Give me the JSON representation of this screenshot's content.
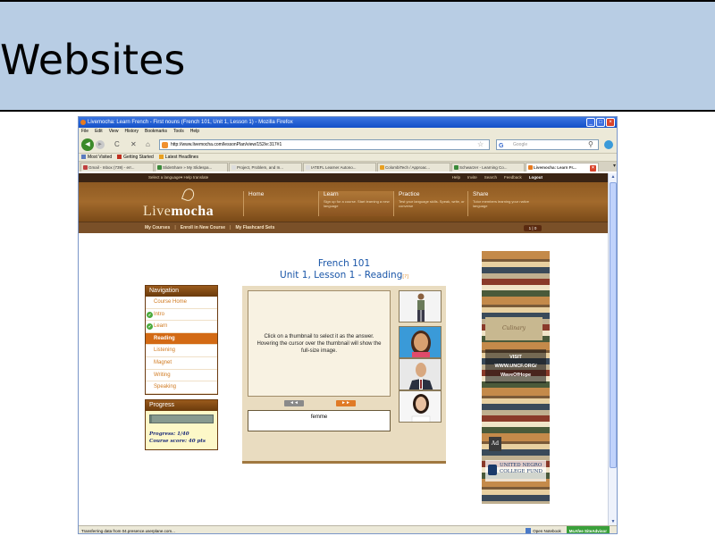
{
  "slide": {
    "title": "Websites"
  },
  "browser": {
    "window_title": "Livemocha: Learn French - First nouns (French 101, Unit 1, Lesson 1) - Mozilla Firefox",
    "menu": [
      "File",
      "Edit",
      "View",
      "History",
      "Bookmarks",
      "Tools",
      "Help"
    ],
    "url": "http://www.livemocha.com/lessonPlan/view/152/e:317#1",
    "search_placeholder": "Google",
    "bookmarks": [
      "Most Visited",
      "Getting Started",
      "Latest Headlines"
    ],
    "tabs": [
      {
        "label": "Gmail - Inbox (739) - err...",
        "active": false
      },
      {
        "label": "SlideShare » My Slidespa...",
        "active": false
      },
      {
        "label": "Project, Problem, and In...",
        "active": false
      },
      {
        "label": "IATEFL Learner Autono...",
        "active": false
      },
      {
        "label": "ColombiTech / Approac...",
        "active": false
      },
      {
        "label": "Schwarzer - Learning Co...",
        "active": false
      },
      {
        "label": "Livemocha: Learn Fr...",
        "active": true
      }
    ],
    "status_text": "Transferring data from 04.presence.userplane.com...",
    "status_right": {
      "notebook": "Open Notebook",
      "mcafee": "McAfee SiteAdvisor"
    },
    "scrollbar_fraction": 0.85
  },
  "livemocha": {
    "top_links_left": "Select a language▾   Help translate",
    "top_links_right": [
      "Help",
      "Invite",
      "Search",
      "Feedback",
      "Logout"
    ],
    "logo_prefix": "Live",
    "logo_suffix": "mocha",
    "nav": [
      {
        "label": "Home",
        "sub": ""
      },
      {
        "label": "Learn",
        "sub": "Sign up for a course. Start learning a new language"
      },
      {
        "label": "Practice",
        "sub": "Test your language skills. Speak, write, or converse"
      },
      {
        "label": "Share",
        "sub": "Tutor members learning your native language"
      }
    ],
    "subnav": [
      "My Courses",
      "Enroll in New Course",
      "My Flashcard Sets"
    ],
    "user_badge": "1 | 0"
  },
  "lesson": {
    "course": "French 101",
    "unit": "Unit 1, Lesson 1 - Reading",
    "unit_suffix": "[?]",
    "navigation_header": "Navigation",
    "navigation": [
      {
        "label": "Course Home",
        "check": false,
        "active": false
      },
      {
        "label": "Intro",
        "check": true,
        "active": false
      },
      {
        "label": "Learn",
        "check": true,
        "active": false
      },
      {
        "label": "Reading",
        "check": false,
        "active": true
      },
      {
        "label": "Listening",
        "check": false,
        "active": false
      },
      {
        "label": "Magnet",
        "check": false,
        "active": false
      },
      {
        "label": "Writing",
        "check": false,
        "active": false
      },
      {
        "label": "Speaking",
        "check": false,
        "active": false
      }
    ],
    "progress_header": "Progress",
    "progress_fraction": 0.025,
    "progress_text": "Progress: 1/40",
    "score_text": "Course score: 40 pts",
    "instruction": "Click on a thumbnail to select it as the answer. Hovering the cursor over the thumbnail will show the full-size image.",
    "prev_label": "◄◄",
    "next_label": "►►",
    "answer": "femme",
    "thumbnails": [
      "man-standing-image",
      "girl-image",
      "businessman-image",
      "woman-image"
    ]
  },
  "ad": {
    "logo_text": "Culinary",
    "line1": "VISIT",
    "line2": "WWW.UNCF.ORG/",
    "line3": "WaveOfHope",
    "ad_mark": "Ad",
    "uncf_line1": "UNITED NEGRO",
    "uncf_line2": "COLLEGE FUND"
  }
}
